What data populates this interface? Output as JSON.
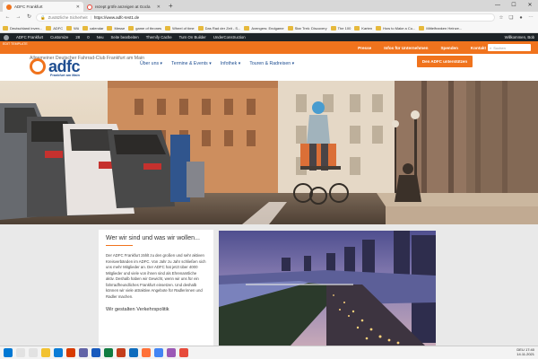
{
  "browser": {
    "tabs": [
      {
        "label": "ADFC Frankfurt",
        "icon": "adfc-favicon",
        "active": true
      },
      {
        "label": "rezept gröfe anzeigen at Gocla",
        "icon": "google-favicon",
        "active": false
      }
    ],
    "new_tab": "+",
    "security_text": "Zusätzliche Sicherheit",
    "url": "https://www.adfc-test1.de",
    "bookmarks": [
      "Deutschland inven...",
      "ADFC",
      "Wü",
      "calendar",
      "Messe",
      "game of thrones",
      "Wheel of time",
      "Das Rad der Zeit - S...",
      "Avengers: Endgame",
      "Star Trek: Discovery",
      "The 100",
      "Karten",
      "How to Make a Cu...",
      "Mittelfranken Heinze..."
    ]
  },
  "wp_admin": {
    "items": [
      "ADFC Frankfurt",
      "Customize",
      "28",
      "0",
      "Neu",
      "Seite bearbeiten",
      "Themify Cache",
      "Turn On Builder",
      "UnderConstruction"
    ],
    "greeting": "Willkommen, Bob",
    "template_badge": "EDIT TEMPLATE"
  },
  "topbar": {
    "links": [
      "Presse",
      "Infos für Unternehmen",
      "Spenden",
      "Kontakt"
    ],
    "search_placeholder": "Suchen"
  },
  "header": {
    "tagline": "Allgemeiner Deutscher Fahrrad-Club Frankfurt am Main",
    "logo_text": "adfc",
    "logo_subtitle": "Frankfurt am Main",
    "nav": [
      "Über uns",
      "Termine & Events",
      "Infothek",
      "Touren & Radreisen"
    ],
    "cta": "Den ADFC unterstützen"
  },
  "intro": {
    "heading": "Wer wir sind und was wir wollen...",
    "body": "Der ADFC Frankfurt zählt zu den großen und sehr aktiven Kreisverbänden im ADFC. Von Jahr zu Jahr schließen sich uns mehr Mitglieder an. Der ADFC hat jetzt über 4000 Mitglieder und viele von ihnen sind als Ehrenamtliche aktiv. Deshalb haben wir Gewicht, wenn wir uns für ein fahrradfreundliches Frankfurt einsetzen. Und deshalb können wir viele attraktive Angebote für Radlerinnen und Radler machen.",
    "subheading": "Wir gestalten Verkehrspolitik"
  },
  "taskbar": {
    "time": "17:40",
    "date": "14.11.2021",
    "locale": "DEU"
  },
  "colors": {
    "brand_orange": "#f0731d",
    "brand_blue": "#1f4e91",
    "wp_admin": "#1d2327"
  }
}
